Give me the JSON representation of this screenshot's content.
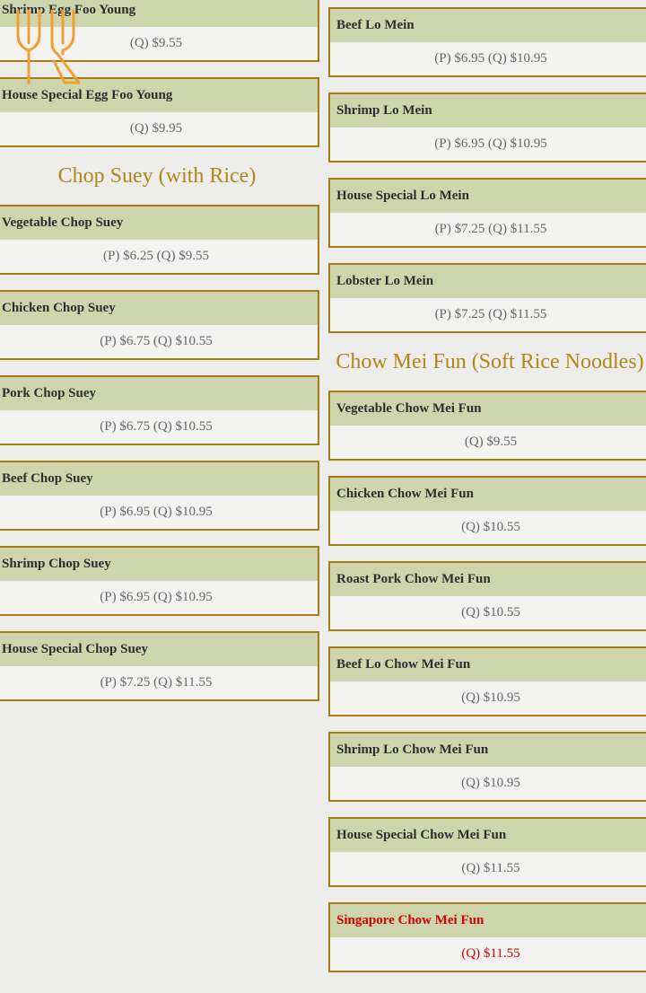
{
  "left": {
    "egg_foo_young": [
      {
        "name": "Shrimp Egg Foo Young",
        "price": "(Q) $9.55"
      },
      {
        "name": "House Special Egg Foo Young",
        "price": "(Q) $9.95"
      }
    ],
    "chop_suey_heading": "Chop Suey (with Rice)",
    "chop_suey": [
      {
        "name": "Vegetable Chop Suey",
        "price": "(P) $6.25 (Q) $9.55"
      },
      {
        "name": "Chicken Chop Suey",
        "price": "(P) $6.75 (Q) $10.55"
      },
      {
        "name": "Pork Chop Suey",
        "price": "(P) $6.75 (Q) $10.55"
      },
      {
        "name": "Beef Chop Suey",
        "price": "(P) $6.95 (Q) $10.95"
      },
      {
        "name": "Shrimp Chop Suey",
        "price": "(P) $6.95 (Q) $10.95"
      },
      {
        "name": "House Special Chop Suey",
        "price": "(P) $7.25 (Q) $11.55"
      }
    ]
  },
  "right": {
    "lo_mein": [
      {
        "name": "Beef Lo Mein",
        "price": "(P) $6.95 (Q) $10.95"
      },
      {
        "name": "Shrimp Lo Mein",
        "price": "(P) $6.95 (Q) $10.95"
      },
      {
        "name": "House Special Lo Mein",
        "price": "(P) $7.25 (Q) $11.55"
      },
      {
        "name": "Lobster Lo Mein",
        "price": "(P) $7.25 (Q) $11.55"
      }
    ],
    "chow_mei_fun_heading": "Chow Mei Fun (Soft Rice Noodles)",
    "chow_mei_fun": [
      {
        "name": "Vegetable Chow Mei Fun",
        "price": "(Q) $9.55"
      },
      {
        "name": "Chicken Chow Mei Fun",
        "price": "(Q) $10.55"
      },
      {
        "name": "Roast Pork Chow Mei Fun",
        "price": "(Q) $10.55"
      },
      {
        "name": "Beef Lo Chow Mei Fun",
        "price": "(Q) $10.95"
      },
      {
        "name": "Shrimp Lo Chow Mei Fun",
        "price": "(Q) $10.95"
      },
      {
        "name": "House Special Chow Mei Fun",
        "price": "(Q) $11.55"
      },
      {
        "name": "Singapore Chow Mei Fun",
        "price": "(Q) $11.55"
      }
    ]
  },
  "colors": {
    "heading": "#b3861a",
    "border": "#a57c18",
    "name_bg": "#cdd5ad",
    "special": "#d60000",
    "icon": "#f0a030"
  },
  "icons": {
    "logo": "fork-and-knife-icon"
  }
}
